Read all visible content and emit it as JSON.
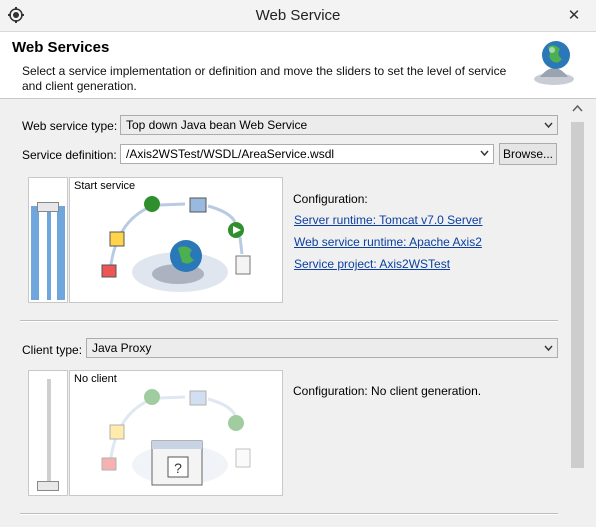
{
  "window": {
    "title": "Web Service",
    "close_glyph": "✕"
  },
  "banner": {
    "title": "Web Services",
    "description": "Select a service implementation or definition and move the sliders to set the level of service and client generation.",
    "icon": "globe-service-icon"
  },
  "service": {
    "type_label": "Web service type:",
    "type_value": "Top down Java bean Web Service",
    "definition_label": "Service definition:",
    "definition_value": "/Axis2WSTest/WSDL/AreaService.wsdl",
    "browse_label": "Browse...",
    "slider_level_label": "Start service",
    "config_heading": "Configuration:",
    "server_runtime_link": "Server runtime: Tomcat v7.0 Server",
    "ws_runtime_link": "Web service runtime: Apache Axis2",
    "project_link": "Service project: Axis2WSTest"
  },
  "client": {
    "type_label": "Client type:",
    "type_value": "Java Proxy",
    "slider_level_label": "No client",
    "config_text": "Configuration: No client generation."
  },
  "colors": {
    "link": "#0b3fa0",
    "slider_active": "#6fa7dd",
    "accent_green": "#2f8f2f"
  }
}
